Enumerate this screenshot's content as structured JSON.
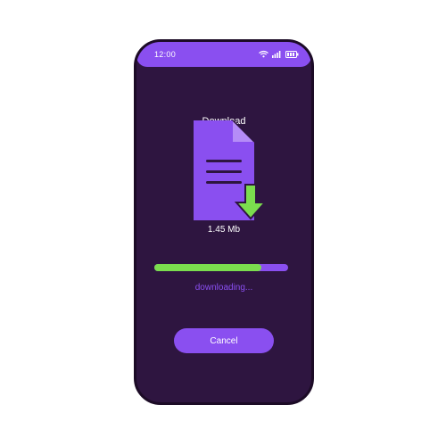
{
  "status_bar": {
    "time": "12:00",
    "icons": [
      "wifi-icon",
      "signal-icon",
      "battery-icon"
    ]
  },
  "screen": {
    "title": "Download",
    "file_icon": "document-download-icon",
    "file_size": "1.45 Mb",
    "progress": 0.8,
    "progress_text": "downloading...",
    "cancel_label": "Cancel"
  },
  "colors": {
    "background": "#2e1540",
    "accent": "#8a4ff0",
    "progress": "#7bdd4e",
    "text": "#ffffff"
  }
}
